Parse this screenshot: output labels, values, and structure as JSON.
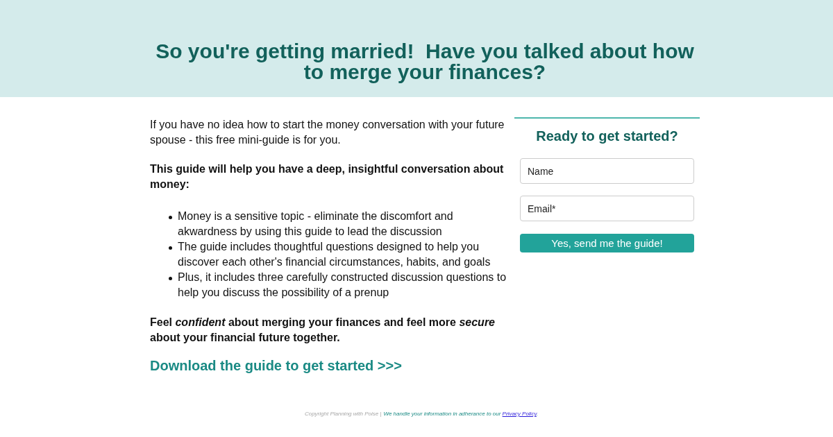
{
  "header": {
    "title": "So you're getting married!  Have you talked about how to merge your finances?"
  },
  "content": {
    "intro": "If you have no idea how to start the money conversation with your future spouse - this free mini-guide is for you.",
    "lead": "This guide will help you have a deep, insightful conversation about money:",
    "bullets": [
      "Money is a sensitive topic - eliminate the discomfort and akwardness by using this guide to lead the discussion",
      "The guide includes thoughtful questions designed to help you discover each other's financial circumstances, habits, and goals",
      "Plus, it includes three carefully constructed discussion questions to help you discuss the possibility of a prenup"
    ],
    "closing": "Feel *confident* about merging your finances and feel more *secure* about your financial future together.",
    "cta_link": "Download the guide to get started >>>"
  },
  "signup_form": {
    "heading": "Ready to get started?",
    "fields": [
      {
        "placeholder": "Name"
      },
      {
        "placeholder": "Email*"
      }
    ],
    "submit": "Yes, send me the guide!"
  },
  "footer": {
    "copyright": "Copyright Planning with Poise |",
    "notice": "We handle your information in adherance to our",
    "privacy_link": "Privacy Policy",
    "notice_end": "."
  }
}
